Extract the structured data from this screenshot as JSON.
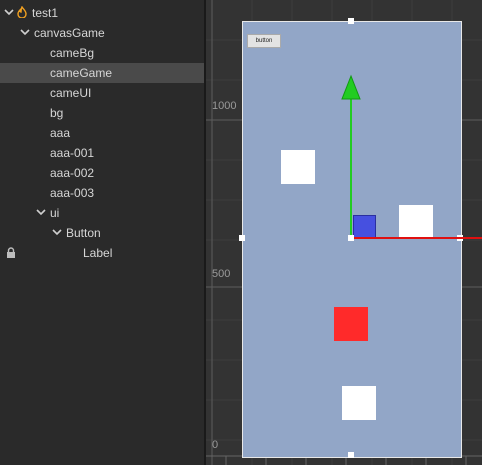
{
  "hierarchy": {
    "items": [
      {
        "label": "test1",
        "level": 0,
        "expanded": true,
        "has_arrow": true,
        "icon": "flame-icon",
        "selected": false,
        "locked": false
      },
      {
        "label": "canvasGame",
        "level": 1,
        "expanded": true,
        "has_arrow": true,
        "selected": false,
        "locked": false
      },
      {
        "label": "cameBg",
        "level": 2,
        "has_arrow": false,
        "selected": false,
        "locked": false
      },
      {
        "label": "cameGame",
        "level": 2,
        "has_arrow": false,
        "selected": true,
        "locked": false
      },
      {
        "label": "cameUI",
        "level": 2,
        "has_arrow": false,
        "selected": false,
        "locked": false
      },
      {
        "label": "bg",
        "level": 2,
        "has_arrow": false,
        "selected": false,
        "locked": false
      },
      {
        "label": "aaa",
        "level": 2,
        "has_arrow": false,
        "selected": false,
        "locked": false
      },
      {
        "label": "aaa-001",
        "level": 2,
        "has_arrow": false,
        "selected": false,
        "locked": false
      },
      {
        "label": "aaa-002",
        "level": 2,
        "has_arrow": false,
        "selected": false,
        "locked": false
      },
      {
        "label": "aaa-003",
        "level": 2,
        "has_arrow": false,
        "selected": false,
        "locked": false
      },
      {
        "label": "ui",
        "level": 2,
        "expanded": true,
        "has_arrow": true,
        "selected": false,
        "locked": false
      },
      {
        "label": "Button",
        "level": 3,
        "expanded": true,
        "has_arrow": true,
        "selected": false,
        "locked": false
      },
      {
        "label": "Label",
        "level": 4,
        "has_arrow": false,
        "selected": false,
        "locked": true
      }
    ]
  },
  "scene": {
    "ruler_labels": {
      "y1000": "1000",
      "y500": "500",
      "y0": "0"
    },
    "button_label": "button",
    "colors": {
      "canvas": "#92a6c7",
      "square": "#ffffff",
      "red_square": "#ff2a2a",
      "blue_square": "#4650e0",
      "y_axis": "#22cc22",
      "x_axis": "#e01010",
      "selection": "#4a4a4a"
    }
  }
}
